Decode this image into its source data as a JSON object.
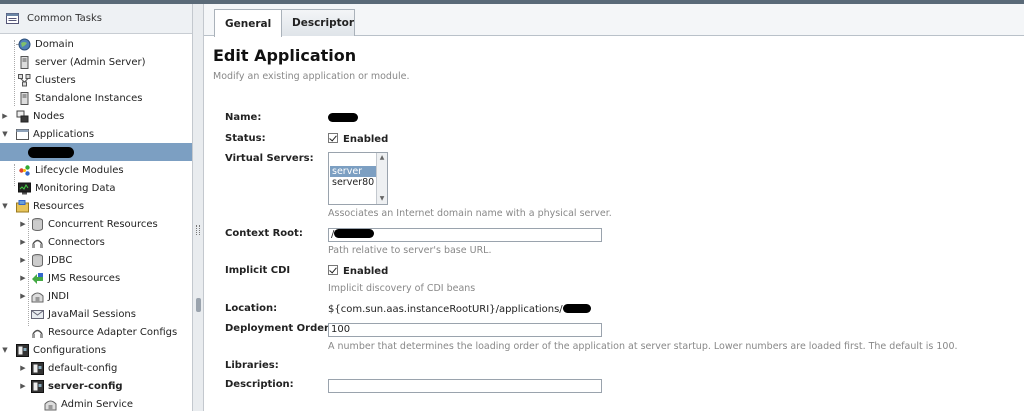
{
  "tree": {
    "header": "Common Tasks",
    "items": [
      {
        "label": "Domain",
        "icon": "globe-icon"
      },
      {
        "label": "server (Admin Server)",
        "icon": "server-icon"
      },
      {
        "label": "Clusters",
        "icon": "cluster-icon"
      },
      {
        "label": "Standalone Instances",
        "icon": "server-icon"
      },
      {
        "label": "Nodes",
        "icon": "nodes-icon"
      },
      {
        "label": "Applications",
        "icon": "applications-icon"
      },
      {
        "label": "",
        "icon": "app-redacted"
      },
      {
        "label": "Lifecycle Modules",
        "icon": "lifecycle-icon"
      },
      {
        "label": "Monitoring Data",
        "icon": "monitor-icon"
      },
      {
        "label": "Resources",
        "icon": "resources-icon"
      },
      {
        "label": "Concurrent Resources",
        "icon": "database-icon"
      },
      {
        "label": "Connectors",
        "icon": "connector-icon"
      },
      {
        "label": "JDBC",
        "icon": "database-icon"
      },
      {
        "label": "JMS Resources",
        "icon": "jms-icon"
      },
      {
        "label": "JNDI",
        "icon": "jndi-icon"
      },
      {
        "label": "JavaMail Sessions",
        "icon": "mail-icon"
      },
      {
        "label": "Resource Adapter Configs",
        "icon": "connector-icon"
      },
      {
        "label": "Configurations",
        "icon": "config-icon"
      },
      {
        "label": "default-config",
        "icon": "config-icon"
      },
      {
        "label": "server-config",
        "icon": "config-icon"
      },
      {
        "label": "Admin Service",
        "icon": "admin-service-icon"
      }
    ]
  },
  "tabs": [
    {
      "label": "General",
      "active": true
    },
    {
      "label": "Descriptor",
      "active": false
    }
  ],
  "page": {
    "title": "Edit Application",
    "subtitle": "Modify an existing application or module."
  },
  "form": {
    "name_label": "Name:",
    "status_label": "Status:",
    "status_value": "Enabled",
    "virtual_servers_label": "Virtual Servers:",
    "virtual_servers_options": [
      "server",
      "server80"
    ],
    "virtual_servers_selected": "server",
    "virtual_servers_help": "Associates an Internet domain name with a physical server.",
    "context_root_label": "Context Root:",
    "context_root_value": "/",
    "context_root_help": "Path relative to server's base URL.",
    "implicit_cdi_label": "Implicit CDI",
    "implicit_cdi_value": "Enabled",
    "implicit_cdi_help": "Implicit discovery of CDI beans",
    "location_label": "Location:",
    "location_value": "${com.sun.aas.instanceRootURI}/applications/",
    "deployment_order_label": "Deployment Order:",
    "deployment_order_value": "100",
    "deployment_order_help": "A number that determines the loading order of the application at server startup. Lower numbers are loaded first. The default is 100.",
    "libraries_label": "Libraries:",
    "description_label": "Description:",
    "description_value": ""
  }
}
